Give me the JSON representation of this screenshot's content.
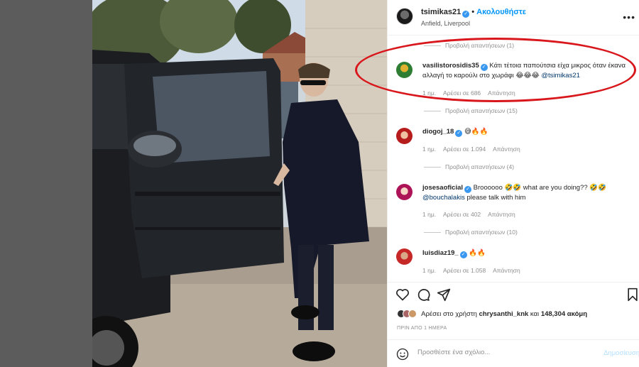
{
  "header": {
    "username": "tsimikas21",
    "separator": "•",
    "follow_label": "Ακολουθήστε",
    "location": "Anfield, Liverpool",
    "more": "•••"
  },
  "comments": {
    "view_replies_top": "Προβολή απαντήσεων (1)",
    "items": [
      {
        "username": "vasilistorosidis35",
        "text": "Κάτι τέτοια παπούτσια είχα μικρος όταν έκανα αλλαγή το καρούλι στο χωράφι 😂😂😂",
        "mention": "@tsimikas21",
        "time": "1 ημ.",
        "likes": "Αρέσει σε 686",
        "reply": "Απάντηση",
        "view_replies": "Προβολή απαντήσεων (15)",
        "avatar_color": "#2e7d32"
      },
      {
        "username": "diogoj_18",
        "text": "😅🔥🔥",
        "time": "1 ημ.",
        "likes": "Αρέσει σε 1.094",
        "reply": "Απάντηση",
        "view_replies": "Προβολή απαντήσεων (4)",
        "avatar_color": "#b71c1c"
      },
      {
        "username": "josesaoficial",
        "text": "Broooooo 🤣🤣 what are you doing?? 🤣🤣",
        "mention": "@bouchalakis",
        "text2": "please talk with him",
        "time": "1 ημ.",
        "likes": "Αρέσει σε 402",
        "reply": "Απάντηση",
        "view_replies": "Προβολή απαντήσεων (10)",
        "avatar_color": "#ad1457"
      },
      {
        "username": "luisdiaz19_",
        "text": "🔥🔥",
        "time": "1 ημ.",
        "likes": "Αρέσει σε 1.058",
        "reply": "Απάντηση",
        "avatar_color": "#c62828"
      }
    ]
  },
  "likes": {
    "prefix": "Αρέσει στο χρήστη",
    "user": "chrysanthi_knk",
    "middle": "και",
    "count": "148,304 ακόμη"
  },
  "date": "ΠΡΙΝ ΑΠΟ 1 ΗΜΕΡΑ",
  "add_comment": {
    "placeholder": "Προσθέστε ένα σχόλιο...",
    "post_label": "Δημοσίευση"
  },
  "colors": {
    "accent": "#0095f6",
    "highlight_oval": "#d8161b",
    "verified": "#3897f0"
  }
}
